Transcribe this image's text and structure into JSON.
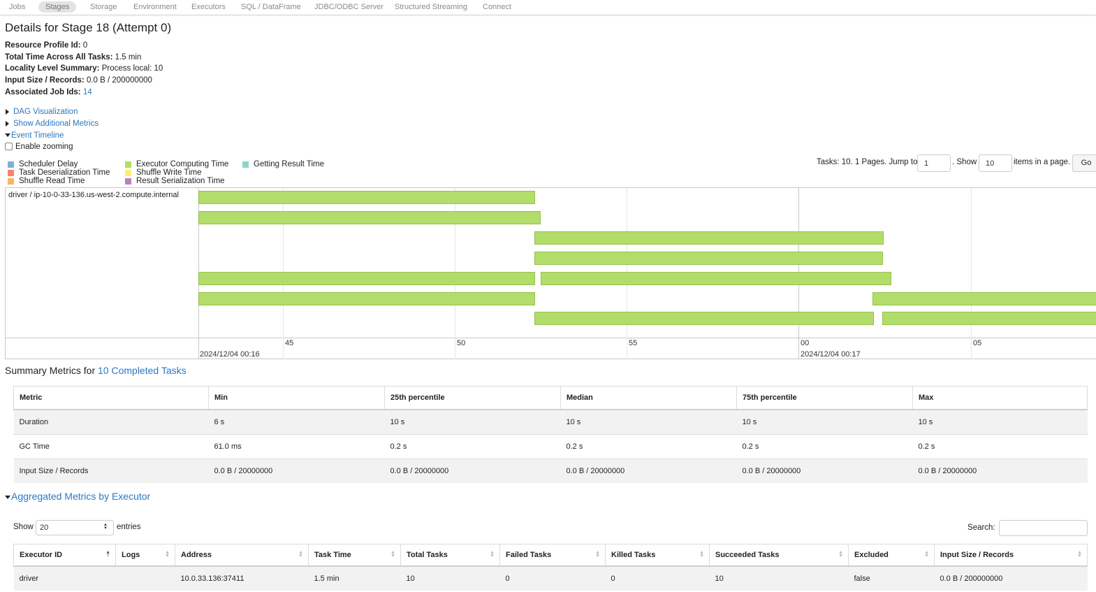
{
  "nav": [
    "Jobs",
    "Stages",
    "Storage",
    "Environment",
    "Executors",
    "SQL / DataFrame",
    "JDBC/ODBC Server",
    "Structured Streaming",
    "Connect"
  ],
  "page": {
    "title": "Details for Stage 18 (Attempt 0)"
  },
  "info": {
    "resource_profile_label": "Resource Profile Id:",
    "resource_profile_value": "0",
    "total_time_label": "Total Time Across All Tasks:",
    "total_time_value": "1.5 min",
    "locality_label": "Locality Level Summary:",
    "locality_value": "Process local: 10",
    "input_label": "Input Size / Records:",
    "input_value": "0.0 B / 200000000",
    "job_ids_label": "Associated Job Ids:",
    "job_ids_value": "14"
  },
  "toggles": {
    "dag": "DAG Visualization",
    "additional": "Show Additional Metrics",
    "timeline": "Event Timeline",
    "zoom": "Enable zooming"
  },
  "legend": [
    {
      "label": "Scheduler Delay",
      "color": "#80b1d3"
    },
    {
      "label": "Task Deserialization Time",
      "color": "#fb8072"
    },
    {
      "label": "Shuffle Read Time",
      "color": "#fdb462"
    },
    {
      "label": "Executor Computing Time",
      "color": "#b3de69"
    },
    {
      "label": "Shuffle Write Time",
      "color": "#ffed6f"
    },
    {
      "label": "Result Serialization Time",
      "color": "#bc80bd"
    },
    {
      "label": "Getting Result Time",
      "color": "#8dd3c7"
    }
  ],
  "pager": {
    "tasks_text": "Tasks: 10. 1 Pages. Jump to",
    "jump_value": "1",
    "show_text": ". Show",
    "show_value": "10",
    "items_text": "items in a page.",
    "go": "Go"
  },
  "timeline": {
    "group_label": "driver / ip-10-0-33-136.us-west-2.compute.internal",
    "ticks": [
      "45",
      "50",
      "55",
      "00",
      "05"
    ],
    "dates": [
      "2024/12/04 00:16",
      "2024/12/04 00:17"
    ]
  },
  "summary": {
    "prefix": "Summary Metrics for",
    "link": "10 Completed Tasks",
    "headers": [
      "Metric",
      "Min",
      "25th percentile",
      "Median",
      "75th percentile",
      "Max"
    ],
    "rows": [
      [
        "Duration",
        "6 s",
        "10 s",
        "10 s",
        "10 s",
        "10 s"
      ],
      [
        "GC Time",
        "61.0 ms",
        "0.2 s",
        "0.2 s",
        "0.2 s",
        "0.2 s"
      ],
      [
        "Input Size / Records",
        "0.0 B / 20000000",
        "0.0 B / 20000000",
        "0.0 B / 20000000",
        "0.0 B / 20000000",
        "0.0 B / 20000000"
      ]
    ]
  },
  "aggregated": {
    "title": "Aggregated Metrics by Executor",
    "show_label": "Show",
    "entries_value": "20",
    "entries_label": "entries",
    "search_label": "Search:",
    "headers": [
      "Executor ID",
      "Logs",
      "Address",
      "Task Time",
      "Total Tasks",
      "Failed Tasks",
      "Killed Tasks",
      "Succeeded Tasks",
      "Excluded",
      "Input Size / Records"
    ],
    "rows": [
      [
        "driver",
        "",
        "10.0.33.136:37411",
        "1.5 min",
        "10",
        "0",
        "0",
        "10",
        "false",
        "0.0 B / 200000000"
      ]
    ]
  }
}
